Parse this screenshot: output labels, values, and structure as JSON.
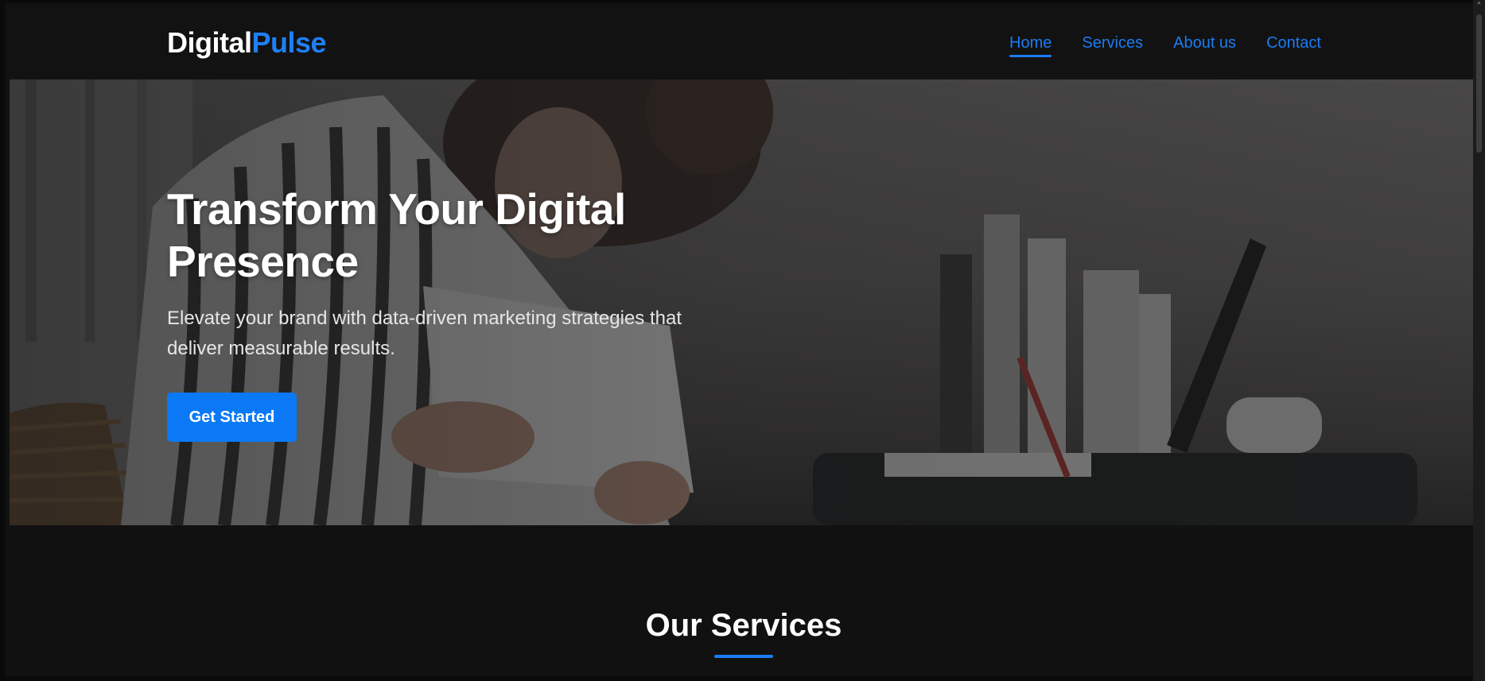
{
  "brand": {
    "part1": "Digital",
    "part2": "Pulse"
  },
  "nav": {
    "items": [
      {
        "label": "Home",
        "active": true
      },
      {
        "label": "Services",
        "active": false
      },
      {
        "label": "About us",
        "active": false
      },
      {
        "label": "Contact",
        "active": false
      }
    ]
  },
  "hero": {
    "title_line1": "Transform Your Digital",
    "title_line2": "Presence",
    "subtitle": "Elevate your brand with data-driven marketing strategies that deliver measurable results.",
    "cta_label": "Get Started"
  },
  "services": {
    "title": "Our Services"
  },
  "colors": {
    "accent": "#1a7cf2",
    "background": "#111111",
    "button": "#0b79f5"
  },
  "icons": {
    "scroll_up": "chevron-up-icon"
  }
}
